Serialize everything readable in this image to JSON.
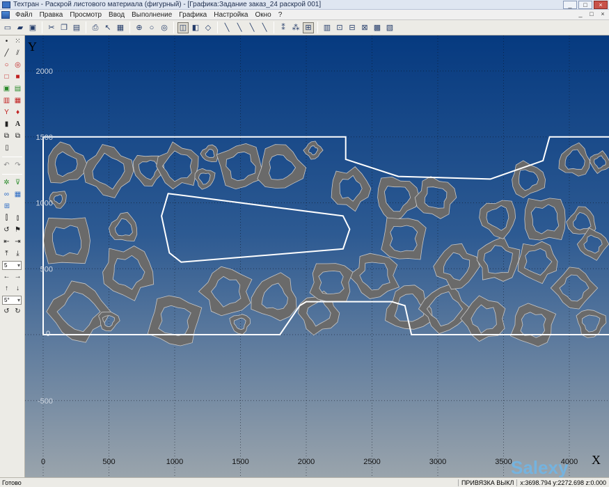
{
  "window": {
    "title": "Техтран - Раскрой листового материала (фигурный) - [Графика:Задание заказ_24 раскрой 001]",
    "controls": [
      "_",
      "□",
      "×"
    ]
  },
  "menu": {
    "items": [
      "Файл",
      "Правка",
      "Просмотр",
      "Ввод",
      "Выполнение",
      "Графика",
      "Настройка",
      "Окно",
      "?"
    ],
    "mdi_controls": [
      "_",
      "□",
      "×"
    ]
  },
  "toolbar": {
    "buttons": [
      "new-file-icon",
      "open-folder-icon",
      "save-icon",
      "cut-icon",
      "copy-icon",
      "paste-icon",
      "print-icon",
      "help-cursor-icon",
      "calculator-icon",
      "zoom-window-icon",
      "zoom-icon",
      "zoom-fit-icon",
      "view-3d-icon",
      "view-3d-alt-icon",
      "cube-icon",
      "line-tool-icon",
      "line-tool-2-icon",
      "line-tool-3-icon",
      "line-tool-4-icon",
      "snap-1-icon",
      "snap-2-icon",
      "snap-3-icon",
      "nc-1-icon",
      "nc-2-icon",
      "nc-3-icon",
      "nc-4-icon",
      "nc-5-icon",
      "nc-6-icon"
    ]
  },
  "palette": {
    "select_values": [
      "5",
      "5°"
    ]
  },
  "plot": {
    "y_axis_title": "Y",
    "x_axis_title": "X",
    "x_ticks": [
      "0",
      "500",
      "1000",
      "1500",
      "2000",
      "2500",
      "3000",
      "3500",
      "4000"
    ],
    "y_ticks": [
      "2000",
      "1500",
      "1000",
      "500",
      "0",
      "-500"
    ],
    "origin_marker": "0",
    "x_tick_values": [
      0,
      500,
      1000,
      1500,
      2000,
      2500,
      3000,
      3500,
      4000
    ],
    "y_tick_values": [
      2000,
      1500,
      1000,
      500,
      0,
      -500
    ],
    "background_top": "#063a80",
    "background_bottom": "#9aa4ac",
    "sheet_outline_color": "#ffffff",
    "part_fill_color": "#6a6a6a",
    "part_edge_color": "#c8c8c8"
  },
  "status": {
    "left": "Готово",
    "snap": "ПРИВЯЗКА ВЫКЛ",
    "coords": "x:3698.794 y:2272.698 z:0.000"
  },
  "watermark": "Salexy"
}
